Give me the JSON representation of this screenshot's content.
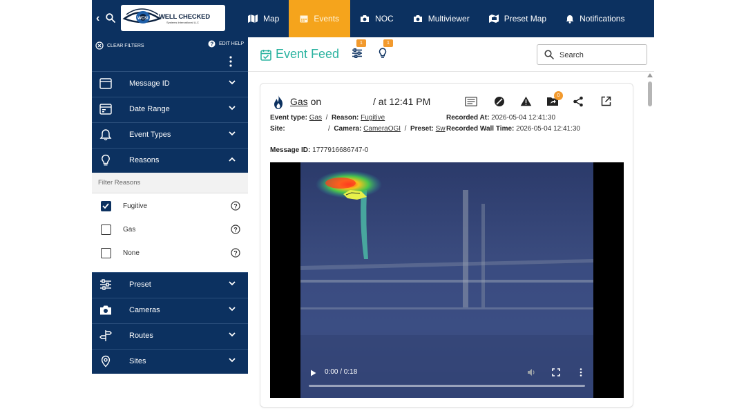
{
  "app": {
    "logo_text": "WELL CHECKED",
    "logo_subtext": "Systems International LLC"
  },
  "nav": {
    "items": [
      {
        "label": "Map",
        "icon": "map-icon"
      },
      {
        "label": "Events",
        "icon": "calendar-icon",
        "active": true
      },
      {
        "label": "NOC",
        "icon": "camera-icon"
      },
      {
        "label": "Multiviewer",
        "icon": "camera-icon"
      },
      {
        "label": "Preset Map",
        "icon": "camera-grid-icon"
      },
      {
        "label": "Notifications",
        "icon": "bell-icon"
      }
    ]
  },
  "sidebar": {
    "clear_filters": "CLEAR FILTERS",
    "edit_help": "EDIT HELP",
    "sections": [
      {
        "label": "Message ID",
        "icon": "id-card-icon"
      },
      {
        "label": "Date Range",
        "icon": "calendar-range-icon"
      },
      {
        "label": "Event Types",
        "icon": "bell-icon"
      },
      {
        "label": "Reasons",
        "icon": "lightbulb-icon",
        "expanded": true
      },
      {
        "label": "Preset",
        "icon": "sliders-icon"
      },
      {
        "label": "Cameras",
        "icon": "camera-icon"
      },
      {
        "label": "Routes",
        "icon": "signpost-icon"
      },
      {
        "label": "Sites",
        "icon": "location-pin-icon"
      }
    ],
    "reasons": {
      "filter_label": "Filter Reasons",
      "items": [
        {
          "label": "Fugitive",
          "checked": true
        },
        {
          "label": "Gas",
          "checked": false
        },
        {
          "label": "None",
          "checked": false
        }
      ]
    }
  },
  "feed": {
    "title": "Event Feed",
    "filter_badge": "1",
    "reason_badge": "1",
    "search_placeholder": "Search"
  },
  "event": {
    "title_link": "Gas",
    "title_suffix": "on",
    "time": "/ at 12:41 PM",
    "event_type_label": "Event type:",
    "event_type": "Gas",
    "reason_label": "Reason:",
    "reason": "Fugitive",
    "site_label": "Site:",
    "camera_label": "Camera:",
    "camera": "CameraOGI",
    "preset_label": "Preset:",
    "preset": "Sw",
    "recorded_at_label": "Recorded At:",
    "recorded_at": "2026-05-04 12:41:30",
    "recorded_wall_label": "Recorded Wall Time:",
    "recorded_wall": "2026-05-04 12:41:30",
    "message_id_label": "Message ID:",
    "message_id": "1777916686747-0",
    "share_badge": "0",
    "video_time": "0:00 / 0:18",
    "video_progress": 0
  },
  "colors": {
    "navy": "#0c3160",
    "active_tab": "#f5a41c",
    "teal": "#2bb3a0",
    "badge": "#f29a2e"
  }
}
